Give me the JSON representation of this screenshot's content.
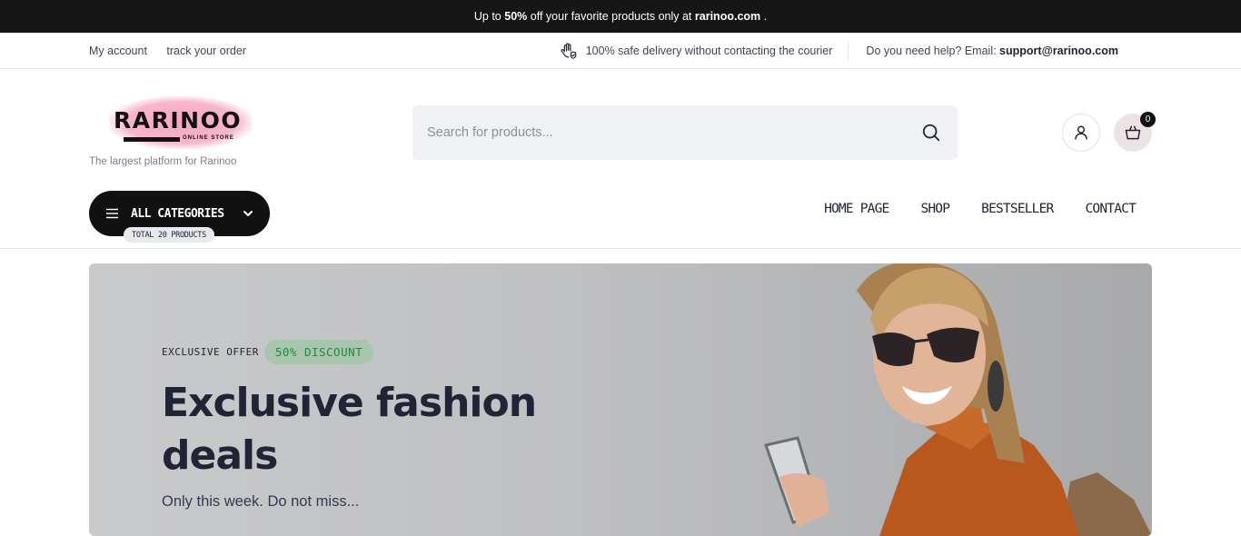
{
  "announcement": {
    "prefix": "Up to ",
    "highlight": "50%",
    "middle": " off your favorite products only at ",
    "site": "rarinoo.com",
    "suffix": " ."
  },
  "topbar": {
    "links": [
      "My account",
      "track your order"
    ],
    "delivery_text": "100% safe delivery without contacting the courier",
    "help_prefix": "Do you need help? Email: ",
    "help_email": "support@rarinoo.com"
  },
  "header": {
    "logo_text": "RARINOO",
    "logo_sub": "ONLINE STORE",
    "tagline": "The largest platform for Rarinoo",
    "search_placeholder": "Search for products...",
    "cart_count": "0"
  },
  "nav": {
    "categories_label": "ALL CATEGORIES",
    "categories_badge": "TOTAL 20 PRODUCTS",
    "items": [
      "HOME PAGE",
      "SHOP",
      "BESTSELLER",
      "CONTACT"
    ]
  },
  "hero": {
    "offer_label": "EXCLUSIVE OFFER",
    "discount": "50% DISCOUNT",
    "title": "Exclusive fashion deals",
    "subtitle": "Only this week. Do not miss..."
  },
  "colors": {
    "accent_dark": "#111111",
    "discount_green": "#1f8a3c",
    "text_primary": "#202435"
  }
}
